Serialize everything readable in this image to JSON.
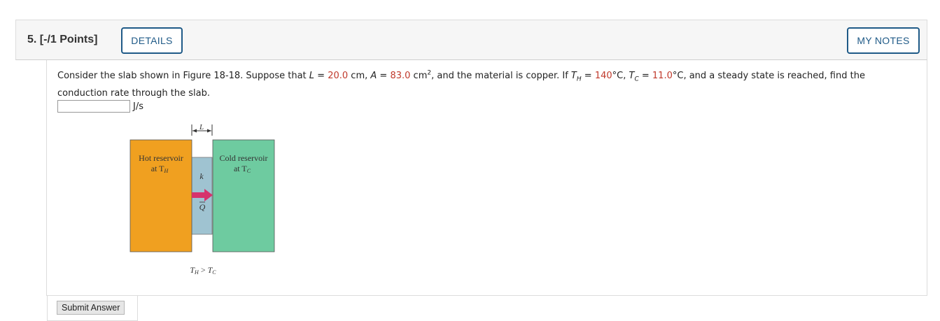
{
  "header": {
    "question_number": "5.",
    "points": "[-/1 Points]",
    "details_label": "DETAILS",
    "notes_label": "MY NOTES"
  },
  "question": {
    "part1": "Consider the slab shown in Figure 18-18. Suppose that ",
    "L_var": "L",
    "eq": " = ",
    "L_value": "20.0",
    "L_unit": " cm, ",
    "A_var": "A",
    "A_value": "83.0",
    "A_unit": " cm",
    "A_exp": "2",
    "part2": ", and the material is copper. If ",
    "TH_var": "T",
    "TH_sub": "H",
    "TH_value": "140",
    "TH_unit": "°C, ",
    "TC_var": "T",
    "TC_sub": "C",
    "TC_value": "11.0",
    "TC_unit": "°C",
    "part3": ", and a steady state is reached, find the conduction rate through the slab."
  },
  "answer": {
    "value": "",
    "unit": "J/s"
  },
  "figure": {
    "hot_line1": "Hot reservoir",
    "hot_line2": "at T",
    "hot_sub": "H",
    "cold_line1": "Cold reservoir",
    "cold_line2": "at T",
    "cold_sub": "C",
    "k_label": "k",
    "q_label": "Q",
    "l_label": "L",
    "relation_a": "T",
    "relation_a_sub": "H",
    "relation_op": " > ",
    "relation_b": "T",
    "relation_b_sub": "C",
    "colors": {
      "hot": "#f0a020",
      "cold": "#6ecba0",
      "slab": "#9fc3d1",
      "arrow": "#d6336c"
    }
  },
  "footer": {
    "submit_label": "Submit Answer"
  }
}
